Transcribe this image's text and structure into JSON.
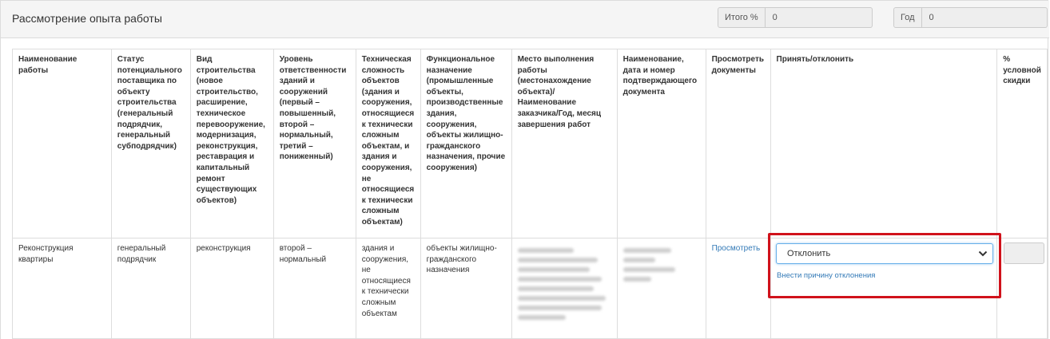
{
  "header": {
    "title": "Рассмотрение опыта работы",
    "total_label": "Итого %",
    "total_value": "0",
    "year_label": "Год",
    "year_value": "0"
  },
  "table": {
    "columns": [
      "Наименование работы",
      "Статус потенциального поставщика по объекту строительства (генеральный подрядчик, генеральный субподрядчик)",
      "Вид строительства (новое строительство, расширение, техническое перевооружение, модернизация, реконструкция, реставрация и капитальный ремонт существующих объектов)",
      "Уровень ответственности зданий и сооружений (первый – повышенный, второй – нормальный, третий – пониженный)",
      "Техническая сложность объектов (здания и сооружения, относящиеся к технически сложным объектам, и здания и сооружения, не относящиеся к технически сложным объектам)",
      "Функциональное назначение (промышленные объекты, производственные здания, сооружения, объекты жилищно-гражданского назначения, прочие сооружения)",
      "Место выполнения работы (местонахождение объекта)/ Наименование заказчика/Год, месяц завершения работ",
      "Наименование, дата и номер подтверждающего документа",
      "Просмотреть документы",
      "Принять/отклонить",
      "% условной скидки"
    ],
    "row": {
      "work_name": "Реконструкция квартиры",
      "status": "генеральный подрядчик",
      "construction_type": "реконструкция",
      "responsibility_level": "второй – нормальный",
      "tech_complexity": "здания и сооружения, не относящиеся к технически сложным объектам",
      "functional_purpose": "объекты жилищно-гражданского назначения",
      "view_link": "Просмотреть",
      "decision_value": "Отклонить",
      "reason_link": "Внести причину отклонения"
    }
  },
  "colors": {
    "highlight": "#d0121b",
    "link": "#337ab7"
  }
}
